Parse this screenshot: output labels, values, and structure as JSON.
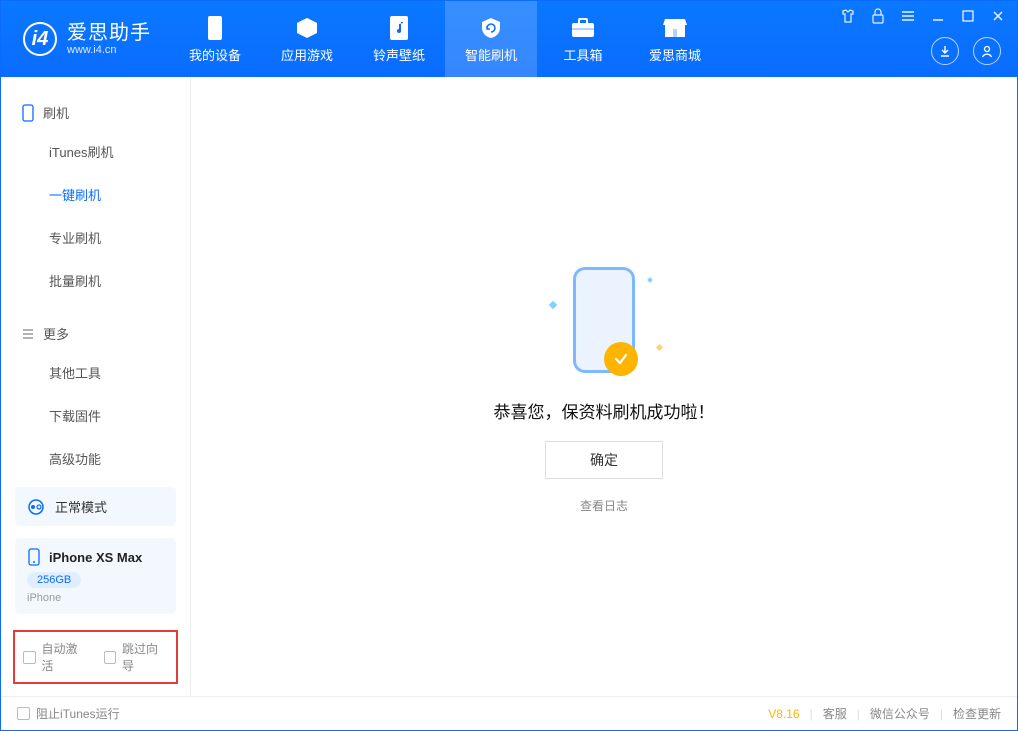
{
  "app": {
    "title": "爱思助手",
    "subtitle": "www.i4.cn"
  },
  "nav": {
    "items": [
      {
        "label": "我的设备"
      },
      {
        "label": "应用游戏"
      },
      {
        "label": "铃声壁纸"
      },
      {
        "label": "智能刷机"
      },
      {
        "label": "工具箱"
      },
      {
        "label": "爱思商城"
      }
    ]
  },
  "sidebar": {
    "group_flash": "刷机",
    "group_more": "更多",
    "flash_items": [
      {
        "label": "iTunes刷机"
      },
      {
        "label": "一键刷机"
      },
      {
        "label": "专业刷机"
      },
      {
        "label": "批量刷机"
      }
    ],
    "more_items": [
      {
        "label": "其他工具"
      },
      {
        "label": "下载固件"
      },
      {
        "label": "高级功能"
      }
    ],
    "mode_label": "正常模式",
    "device": {
      "name": "iPhone XS Max",
      "capacity": "256GB",
      "type": "iPhone"
    },
    "checks": {
      "auto_activate": "自动激活",
      "skip_guide": "跳过向导"
    }
  },
  "main": {
    "success_message": "恭喜您，保资料刷机成功啦！",
    "ok_button": "确定",
    "view_log": "查看日志"
  },
  "statusbar": {
    "block_itunes": "阻止iTunes运行",
    "version": "V8.16",
    "customer_service": "客服",
    "wechat": "微信公众号",
    "check_update": "检查更新"
  }
}
